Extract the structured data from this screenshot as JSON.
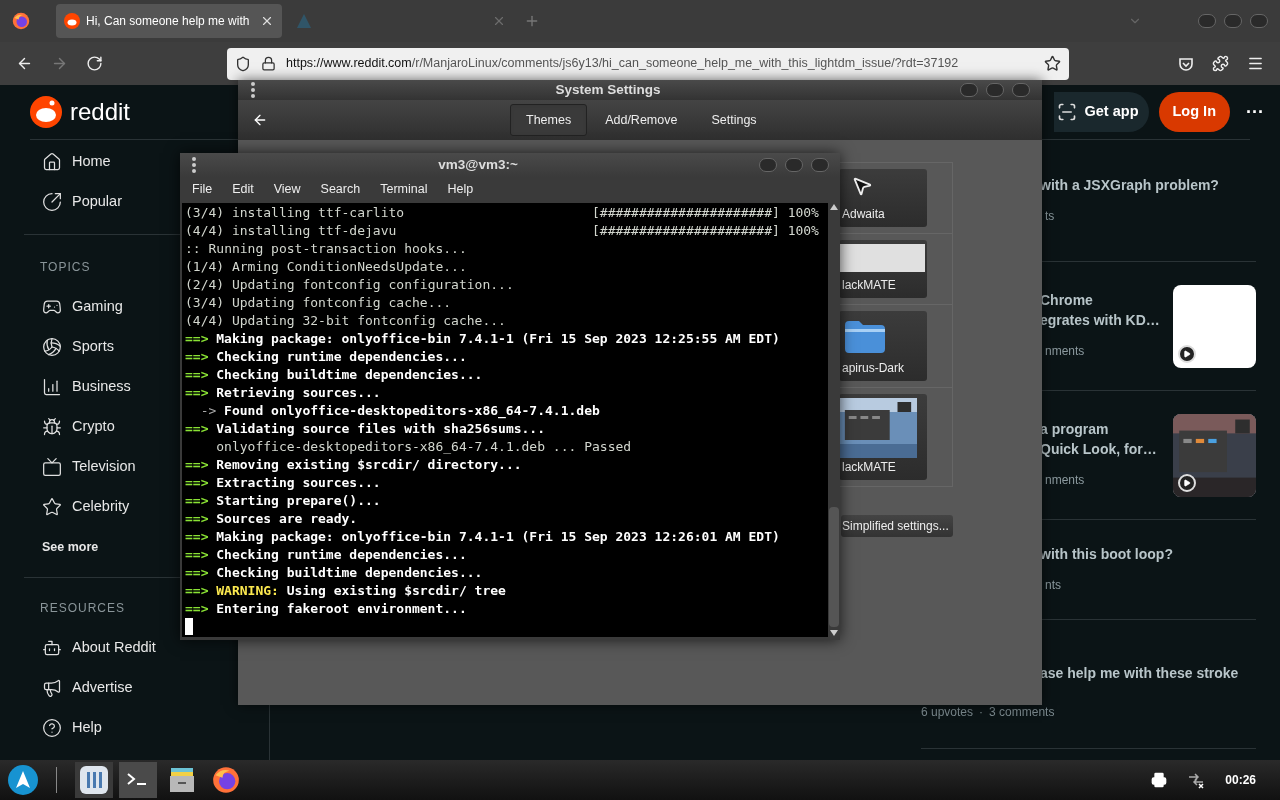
{
  "browser": {
    "tabs": [
      {
        "title": "Hi, Can someone help me with",
        "selected": true
      },
      {
        "selected": false
      }
    ],
    "nav": [
      {
        "kind": "back",
        "disabled": false
      },
      {
        "kind": "forward",
        "disabled": true
      },
      {
        "kind": "reload",
        "disabled": false
      }
    ],
    "url_host": "https://www.reddit.com",
    "url_path": "/r/ManjaroLinux/comments/js6y13/hi_can_someone_help_me_with_this_lightdm_issue/?rdt=37192"
  },
  "reddit": {
    "logo": "reddit",
    "get_app": "Get app",
    "login": "Log In",
    "more": "···",
    "nav": [
      "Home",
      "Popular"
    ],
    "topics_heading": "TOPICS",
    "topics": [
      "Gaming",
      "Sports",
      "Business",
      "Crypto",
      "Television",
      "Celebrity"
    ],
    "see_more": "See more",
    "resources_heading": "RESOURCES",
    "resources": [
      "About Reddit",
      "Advertise",
      "Help"
    ],
    "posts": [
      {
        "title_lines": [
          "with a JSXGraph problem?"
        ],
        "meta": "ts"
      },
      {
        "title_lines": [
          "Chrome",
          "egrates with KD…"
        ],
        "meta": "nments",
        "thumbnail": {
          "kind": "blank"
        }
      },
      {
        "title_lines": [
          "a program",
          "Quick Look, for…"
        ],
        "meta": "nments",
        "thumbnail": {
          "kind": "picture"
        }
      },
      {
        "title_lines": [
          "with this boot loop?"
        ],
        "meta": "nts"
      },
      {
        "title_lines": [
          "ase help me with these stroke"
        ],
        "upvotes": "6 upvotes",
        "separator": "·",
        "comments": "3 comments"
      }
    ]
  },
  "settings": {
    "title": "System Settings",
    "tabs": [
      {
        "label": "Themes",
        "selected": true
      },
      {
        "label": "Add/Remove",
        "selected": false
      },
      {
        "label": "Settings",
        "selected": false
      }
    ],
    "themes": [
      {
        "kind": "cursor",
        "label": "Adwaita"
      },
      {
        "kind": "blank",
        "label": "lackMATE"
      },
      {
        "kind": "folder",
        "label": "apirus-Dark"
      },
      {
        "kind": "picture",
        "label": "lackMATE"
      }
    ],
    "simplified_button": "Simplified settings..."
  },
  "terminal": {
    "title": "vm3@vm3:~",
    "menu": [
      "File",
      "Edit",
      "View",
      "Search",
      "Terminal",
      "Help"
    ],
    "lines": [
      {
        "kind": "progress",
        "text": "(3/4) installing ttf-carlito",
        "bar": "[######################]",
        "percent": "100%"
      },
      {
        "kind": "progress",
        "text": "(4/4) installing ttf-dejavu",
        "bar": "[######################]",
        "percent": "100%"
      },
      {
        "kind": "plain",
        "text": ":: Running post-transaction hooks..."
      },
      {
        "kind": "plain",
        "text": "(1/4) Arming ConditionNeedsUpdate..."
      },
      {
        "kind": "plain",
        "text": "(2/4) Updating fontconfig configuration..."
      },
      {
        "kind": "plain",
        "text": "(3/4) Updating fontconfig cache..."
      },
      {
        "kind": "plain",
        "text": "(4/4) Updating 32-bit fontconfig cache..."
      },
      {
        "kind": "step",
        "prefix": "==>",
        "text": "Making package: onlyoffice-bin 7.4.1-1 (Fri 15 Sep 2023 12:25:55 AM EDT)"
      },
      {
        "kind": "step",
        "prefix": "==>",
        "text": "Checking runtime dependencies..."
      },
      {
        "kind": "step",
        "prefix": "==>",
        "text": "Checking buildtime dependencies..."
      },
      {
        "kind": "step",
        "prefix": "==>",
        "text": "Retrieving sources..."
      },
      {
        "kind": "sub",
        "prefix": "->",
        "text": "Found onlyoffice-desktopeditors-x86_64-7.4.1.deb"
      },
      {
        "kind": "step",
        "prefix": "==>",
        "text": "Validating source files with sha256sums..."
      },
      {
        "kind": "detail",
        "text": "onlyoffice-desktopeditors-x86_64-7.4.1.deb ... Passed"
      },
      {
        "kind": "step",
        "prefix": "==>",
        "text": "Removing existing $srcdir/ directory..."
      },
      {
        "kind": "step",
        "prefix": "==>",
        "text": "Extracting sources..."
      },
      {
        "kind": "step",
        "prefix": "==>",
        "text": "Starting prepare()..."
      },
      {
        "kind": "step",
        "prefix": "==>",
        "text": "Sources are ready."
      },
      {
        "kind": "step",
        "prefix": "==>",
        "text": "Making package: onlyoffice-bin 7.4.1-1 (Fri 15 Sep 2023 12:26:01 AM EDT)"
      },
      {
        "kind": "step",
        "prefix": "==>",
        "text": "Checking runtime dependencies..."
      },
      {
        "kind": "step",
        "prefix": "==>",
        "text": "Checking buildtime dependencies..."
      },
      {
        "kind": "warning",
        "prefix": "==>",
        "label": "WARNING:",
        "text": "Using existing $srcdir/ tree"
      },
      {
        "kind": "step",
        "prefix": "==>",
        "text": "Entering fakeroot environment..."
      }
    ]
  },
  "taskbar": {
    "clock": "00:26"
  }
}
